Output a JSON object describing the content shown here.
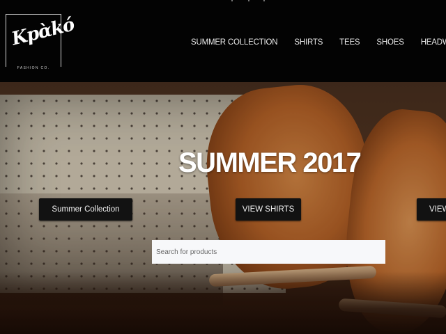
{
  "brand": {
    "script": "Kpὰkó",
    "sub": "FASHION CO."
  },
  "nav": [
    {
      "label": "SUMMER COLLECTION"
    },
    {
      "label": "SHIRTS"
    },
    {
      "label": "TEES"
    },
    {
      "label": "SHOES"
    },
    {
      "label": "HEADWEAR"
    }
  ],
  "hero": {
    "title": "SUMMER 2017",
    "buttons": [
      {
        "label": "Summer Collection"
      },
      {
        "label": "VIEW SHIRTS"
      },
      {
        "label": "VIEW"
      }
    ],
    "search_placeholder": "Search for products"
  }
}
